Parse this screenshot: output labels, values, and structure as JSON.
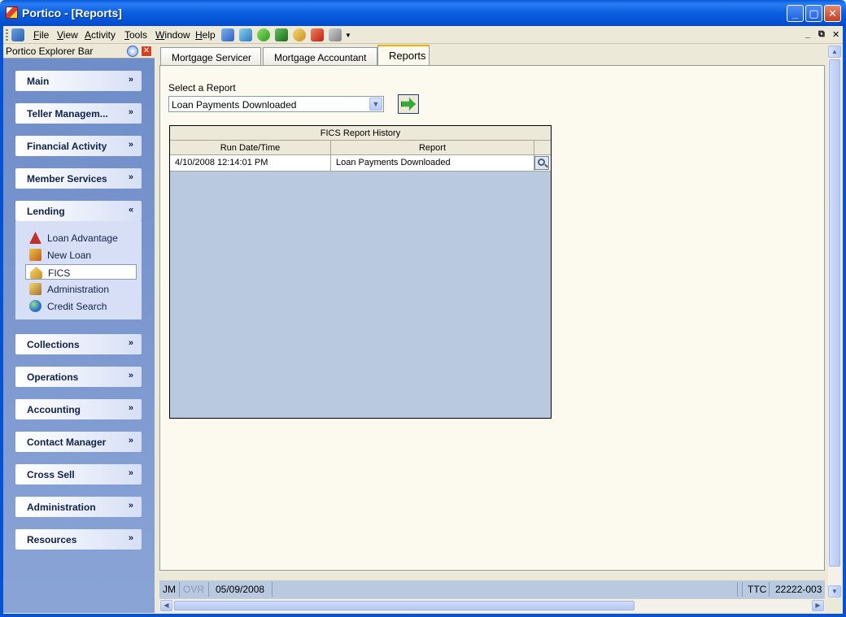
{
  "window": {
    "title": "Portico - [Reports]"
  },
  "menu": {
    "items": [
      {
        "label": "File",
        "accel": "F",
        "rest": "ile"
      },
      {
        "label": "View",
        "accel": "V",
        "rest": "iew"
      },
      {
        "label": "Activity",
        "accel": "A",
        "rest": "ctivity"
      },
      {
        "label": "Tools",
        "accel": "T",
        "rest": "ools"
      },
      {
        "label": "Window",
        "accel": "W",
        "rest": "indow"
      },
      {
        "label": "Help",
        "accel": "H",
        "rest": "elp"
      }
    ],
    "mdi_min": "_",
    "mdi_restore": "⧉",
    "mdi_close": "✕"
  },
  "explorer": {
    "title": "Portico Explorer Bar",
    "groups": [
      {
        "label": "Main",
        "expanded": false
      },
      {
        "label": "Teller Managem...",
        "expanded": false
      },
      {
        "label": "Financial Activity",
        "expanded": false
      },
      {
        "label": "Member Services",
        "expanded": false
      },
      {
        "label": "Lending",
        "expanded": true
      },
      {
        "label": "Collections",
        "expanded": false
      },
      {
        "label": "Operations",
        "expanded": false
      },
      {
        "label": "Accounting",
        "expanded": false
      },
      {
        "label": "Contact Manager",
        "expanded": false
      },
      {
        "label": "Cross Sell",
        "expanded": false
      },
      {
        "label": "Administration",
        "expanded": false
      },
      {
        "label": "Resources",
        "expanded": false
      }
    ],
    "lending_items": [
      {
        "label": "Loan Advantage",
        "icon": "loan-advantage-icon",
        "color": "#c0302a"
      },
      {
        "label": "New Loan",
        "icon": "new-loan-icon",
        "color": "#d89a20"
      },
      {
        "label": "FICS",
        "icon": "fics-icon",
        "color": "#e8b040",
        "selected": true
      },
      {
        "label": "Administration",
        "icon": "administration-icon",
        "color": "#c89040"
      },
      {
        "label": "Credit Search",
        "icon": "globe-icon",
        "color": "#2a70c8"
      }
    ]
  },
  "tabs": [
    {
      "label": "Mortgage Servicer",
      "active": false
    },
    {
      "label": "Mortgage Accountant",
      "active": false
    },
    {
      "label": "Reports",
      "active": true
    }
  ],
  "report_select": {
    "label": "Select a Report",
    "value": "Loan Payments Downloaded"
  },
  "history": {
    "title": "FICS Report History",
    "columns": [
      "Run Date/Time",
      "Report"
    ],
    "rows": [
      {
        "run_date": "4/10/2008 12:14:01 PM",
        "report": "Loan Payments Downloaded"
      }
    ]
  },
  "status": {
    "user": "JM",
    "ovr": "OVR",
    "date": "05/09/2008",
    "ttc": "TTC",
    "terminal": "22222-003"
  }
}
